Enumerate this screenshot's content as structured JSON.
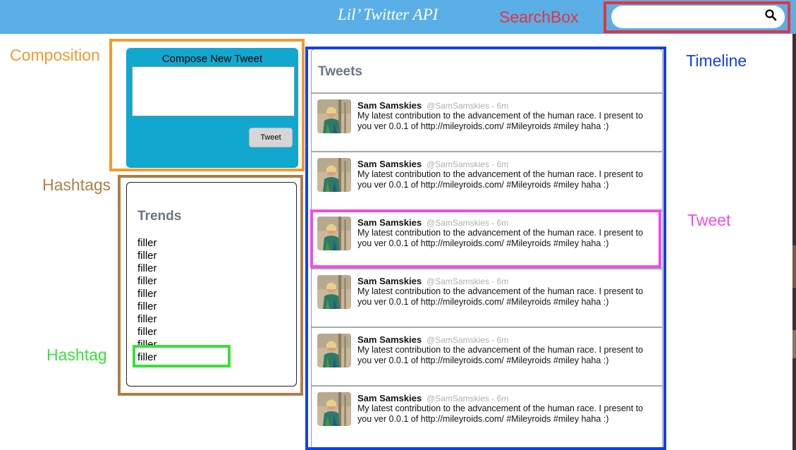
{
  "header": {
    "title": "Lil’ Twitter API",
    "search_placeholder": ""
  },
  "annotations": {
    "searchbox": "SearchBox",
    "composition": "Composition",
    "timeline": "Timeline",
    "hashtags": "Hashtags",
    "tweet": "Tweet",
    "hashtag": "Hashtag"
  },
  "annotation_colors": {
    "searchbox": "#e8323c",
    "composition": "#f39a2c",
    "timeline": "#1340e8",
    "hashtags": "#b07d45",
    "tweet": "#f04ce6",
    "hashtag": "#3ae03a"
  },
  "compose": {
    "heading": "Compose New Tweet",
    "text_value": "",
    "button_label": "Tweet"
  },
  "trends": {
    "heading": "Trends",
    "items": [
      "filler",
      "filler",
      "filler",
      "filler",
      "filler",
      "filler",
      "filler",
      "filler",
      "filler",
      "filler"
    ]
  },
  "timeline": {
    "heading": "Tweets",
    "tweets": [
      {
        "name": "Sam Samskies",
        "handle": "@SamSamskies - 6m",
        "text": "My latest contribution to the advancement of the human race. I present to you ver 0.0.1 of http://mileyroids.com/ #Mileyroids #miley haha :)"
      },
      {
        "name": "Sam Samskies",
        "handle": "@SamSamskies - 6m",
        "text": "My latest contribution to the advancement of the human race. I present to you ver 0.0.1 of http://mileyroids.com/ #Mileyroids #miley haha :)"
      },
      {
        "name": "Sam Samskies",
        "handle": "@SamSamskies - 6m",
        "text": "My latest contribution to the advancement of the human race. I present to you ver 0.0.1 of http://mileyroids.com/ #Mileyroids #miley haha :)"
      },
      {
        "name": "Sam Samskies",
        "handle": "@SamSamskies - 6m",
        "text": "My latest contribution to the advancement of the human race. I present to you ver 0.0.1 of http://mileyroids.com/ #Mileyroids #miley haha :)"
      },
      {
        "name": "Sam Samskies",
        "handle": "@SamSamskies - 6m",
        "text": "My latest contribution to the advancement of the human race. I present to you ver 0.0.1 of http://mileyroids.com/ #Mileyroids #miley haha :)"
      },
      {
        "name": "Sam Samskies",
        "handle": "@SamSamskies - 6m",
        "text": "My latest contribution to the advancement of the human race. I present to you ver 0.0.1 of http://mileyroids.com/ #Mileyroids #miley haha :)"
      }
    ]
  },
  "icons": {
    "search": "search-icon",
    "avatar": "avatar-image"
  },
  "colors": {
    "header_bg": "#5aaee6",
    "compose_bg": "#11a7cf",
    "heading_gray": "#69757f",
    "handle_gray": "#a8b0b7"
  }
}
